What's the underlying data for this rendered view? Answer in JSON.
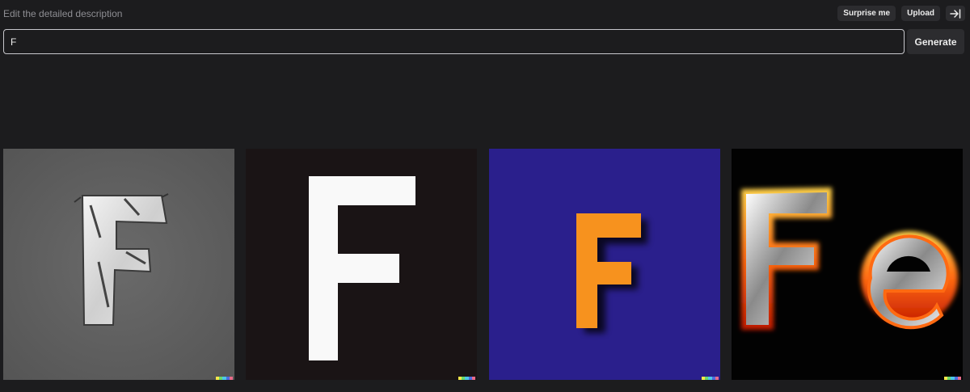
{
  "prompt": {
    "label": "Edit the detailed description",
    "value": "F"
  },
  "actions": {
    "surprise_label": "Surprise me",
    "upload_label": "Upload",
    "collapse_icon": "collapse-right-icon",
    "generate_label": "Generate"
  },
  "results": [
    {
      "style": "metallic-f-on-grey",
      "background": "#5d5d5d"
    },
    {
      "style": "white-f-on-black",
      "background": "#1a1415"
    },
    {
      "style": "orange-f-on-indigo",
      "background": "#2a1f8c"
    },
    {
      "style": "flaming-fe-on-black",
      "background": "#020202"
    }
  ],
  "signature_colors": [
    "#f7e84a",
    "#6ad86a",
    "#4cc6e8",
    "#4e6bdf",
    "#e86a8a"
  ]
}
